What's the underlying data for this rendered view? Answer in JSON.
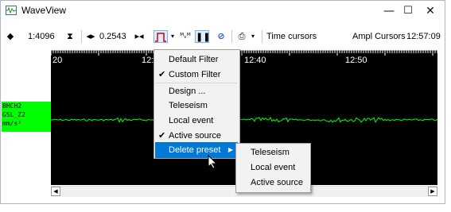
{
  "window": {
    "title": "WaveView",
    "controls": [
      "—",
      "☐",
      "✕"
    ]
  },
  "toolbar": {
    "zoom": "1:4096",
    "scale": "0.2543",
    "time_cursors": "Time cursors",
    "ampl_cursors": "Ampl Cursors",
    "clock": "12:57:09"
  },
  "channel": {
    "lines": [
      "BHCH2",
      "GSL_Z2",
      "mm/s²"
    ],
    "color": "#00ff00"
  },
  "time_axis": {
    "ticks": [
      "20",
      "12:3",
      "12:40",
      "12:50"
    ]
  },
  "filter_menu": {
    "items": [
      {
        "label": "Default Filter",
        "checked": false
      },
      {
        "label": "Custom Filter",
        "checked": true
      },
      {
        "label": "Design ...",
        "checked": false
      },
      {
        "label": "Teleseism",
        "checked": false
      },
      {
        "label": "Local event",
        "checked": false
      },
      {
        "label": "Active source",
        "checked": true
      },
      {
        "label": "Delete preset",
        "checked": false,
        "highlighted": true,
        "submenu": true
      }
    ]
  },
  "delete_preset_submenu": {
    "items": [
      "Teleseism",
      "Local event",
      "Active source"
    ]
  },
  "colors": {
    "accent": "#0078d7",
    "trace": "#00ff00",
    "plot_background": "#000000",
    "filter_icon": "#cc0000"
  }
}
